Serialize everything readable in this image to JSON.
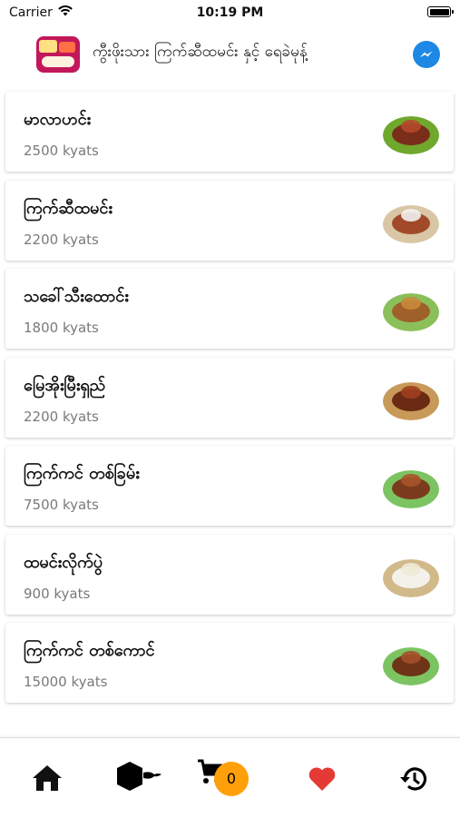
{
  "status_bar": {
    "carrier": "Carrier",
    "time": "10:19 PM"
  },
  "header": {
    "title": "ကွီးဖိုးသား ကြက်ဆီထမင်း နှင့် ရေခဲမုန့်",
    "logo_icon": "shop-logo-icon",
    "messenger_icon": "messenger-icon"
  },
  "menu": {
    "items": [
      {
        "name": "မာလာဟင်း",
        "price": "2500 kyats",
        "image": "curry-dish-image",
        "rim": "#6fa82c",
        "food": "#7a2e1a",
        "food2": "#b5482a"
      },
      {
        "name": "ကြက်ဆီထမင်း",
        "price": "2200 kyats",
        "image": "chicken-rice-image",
        "rim": "#d9c6a5",
        "food": "#a04a2a",
        "food2": "#f1f1ee"
      },
      {
        "name": "သခေါ်သီးထောင်း",
        "price": "1800 kyats",
        "image": "salad-dish-image",
        "rim": "#8bbf5a",
        "food": "#a0602a",
        "food2": "#c98a3a"
      },
      {
        "name": "မြေအိုးမြီးရှည်",
        "price": "2200 kyats",
        "image": "clay-pot-noodle-image",
        "rim": "#c89a5a",
        "food": "#6b2a14",
        "food2": "#a03e1e"
      },
      {
        "name": "ကြက်ကင် တစ်ခြမ်း",
        "price": "7500 kyats",
        "image": "half-grilled-chicken-image",
        "rim": "#7cc462",
        "food": "#7a3c1c",
        "food2": "#a8542a"
      },
      {
        "name": "ထမင်းလိုက်ပွဲ",
        "price": "900 kyats",
        "image": "rice-plate-image",
        "rim": "#d2b98a",
        "food": "#f3f1ea",
        "food2": "#efe9d6"
      },
      {
        "name": "ကြက်ကင် တစ်ကောင်",
        "price": "15000 kyats",
        "image": "whole-grilled-chicken-image",
        "rim": "#7cc462",
        "food": "#6e3418",
        "food2": "#a3502a"
      }
    ]
  },
  "bottom_nav": {
    "home_icon": "home-icon",
    "category_icon": "category-icon",
    "cart_icon": "cart-icon",
    "cart_count": "0",
    "favorite_icon": "heart-icon",
    "history_icon": "history-icon",
    "badge_color": "#ff9f0a",
    "heart_color": "#e53935"
  }
}
